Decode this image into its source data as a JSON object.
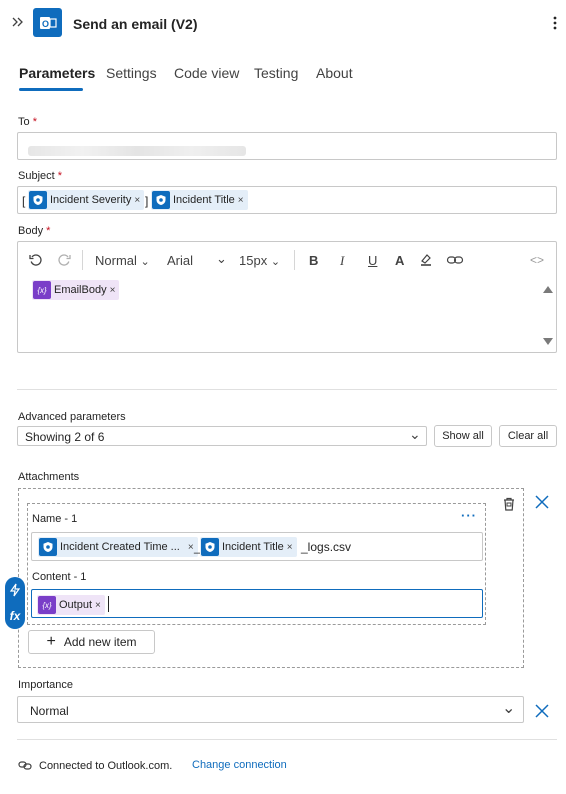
{
  "header": {
    "title": "Send an email (V2)",
    "expand_icon": "double-chevron-right-icon",
    "app_icon": "outlook-icon",
    "more_icon": "more-vertical-icon"
  },
  "tabs": [
    {
      "label": "Parameters",
      "active": true
    },
    {
      "label": "Settings",
      "active": false
    },
    {
      "label": "Code view",
      "active": false
    },
    {
      "label": "Testing",
      "active": false
    },
    {
      "label": "About",
      "active": false
    }
  ],
  "to": {
    "label": "To",
    "required_mark": "*"
  },
  "subject": {
    "label": "Subject",
    "required_mark": "*",
    "prefix": "[",
    "token1": "Incident Severity",
    "middle": "]",
    "token2": "Incident Title",
    "remove": "×"
  },
  "body": {
    "label": "Body",
    "required_mark": "*",
    "toolbar": {
      "undo_icon": "undo-icon",
      "redo_icon": "redo-icon",
      "format": "Normal",
      "font": "Arial",
      "size": "15px",
      "bold": "B",
      "italic": "I",
      "underline": "U",
      "font_color": "A",
      "code_view": "<>"
    },
    "token": "EmailBody",
    "token_icon": "{x}",
    "remove": "×"
  },
  "advanced": {
    "label": "Advanced parameters",
    "select_value": "Showing 2 of 6",
    "show_all": "Show all",
    "clear_all": "Clear all"
  },
  "attachments": {
    "label": "Attachments",
    "name_label": "Name - 1",
    "name_token1": "Incident Created Time ...",
    "name_sep": "_",
    "name_token2": "Incident Title",
    "name_suffix": "_logs.csv",
    "content_label": "Content - 1",
    "content_token": "Output",
    "content_token_icon": "{x}",
    "remove": "×",
    "more": "···",
    "add_item": "Add new item",
    "add_sign": "+",
    "remove_item_icon": "close-icon",
    "delete_icon": "trash-icon",
    "side_icons": [
      "lightning-icon",
      "fx-icon"
    ],
    "fx_label": "fx"
  },
  "importance": {
    "label": "Importance",
    "value": "Normal"
  },
  "footer": {
    "connected": "Connected to Outlook.com.",
    "change": "Change connection",
    "icon": "connection-icon"
  },
  "colors": {
    "accent": "#0f6cbd",
    "token_blue": "#e4eef8",
    "token_purple": "#efe4f7",
    "required": "#c50f1f"
  }
}
